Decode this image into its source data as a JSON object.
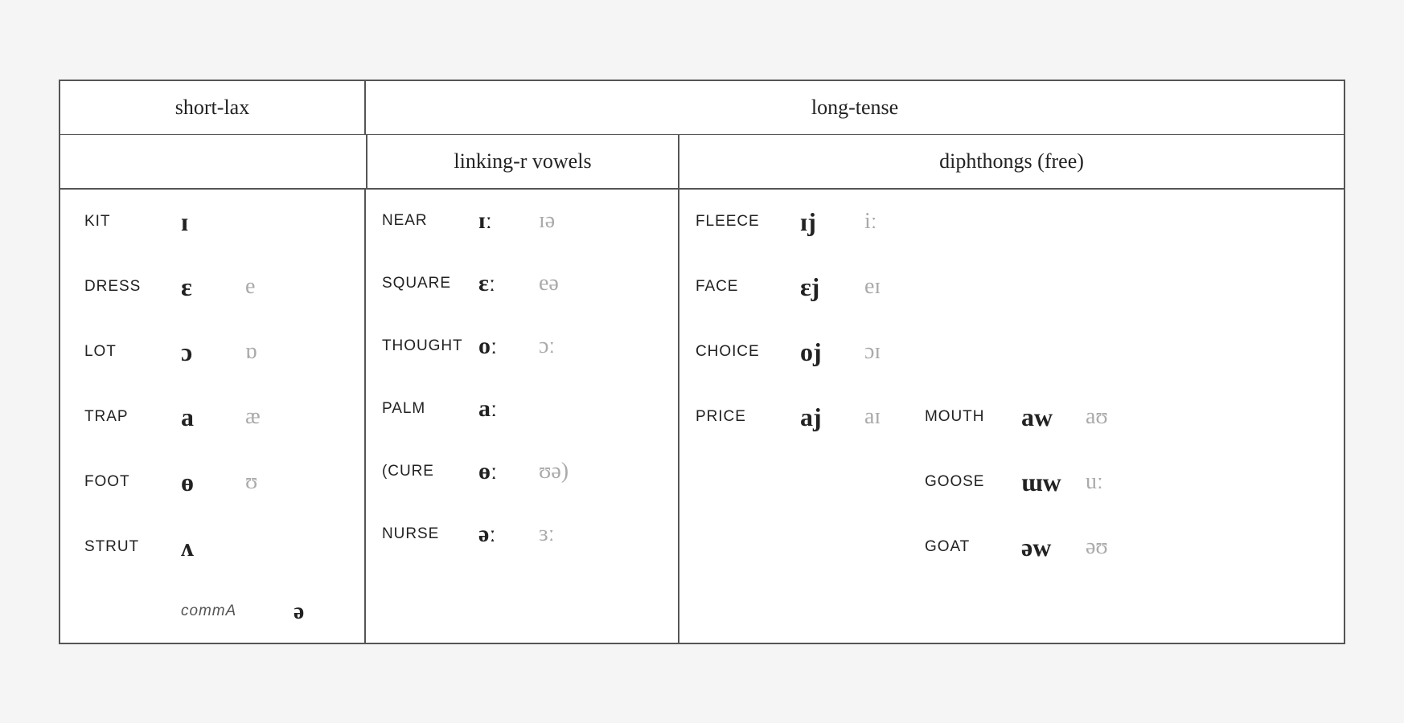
{
  "headers": {
    "short_lax": "short-lax",
    "long_tense": "long-tense",
    "linking_r": "linking-r vowels",
    "diphthongs": "diphthongs (free)"
  },
  "short_lax_rows": [
    {
      "word": "KIT",
      "ipa_primary": "ɪ",
      "ipa_secondary": ""
    },
    {
      "word": "DRESS",
      "ipa_primary": "ɛ",
      "ipa_secondary": "e"
    },
    {
      "word": "LOT",
      "ipa_primary": "ɔ",
      "ipa_secondary": "ɒ"
    },
    {
      "word": "TRAP",
      "ipa_primary": "a",
      "ipa_secondary": "æ"
    },
    {
      "word": "FOOT",
      "ipa_primary": "ɵ",
      "ipa_secondary": "ʊ"
    },
    {
      "word": "STRUT",
      "ipa_primary": "ʌ",
      "ipa_secondary": ""
    }
  ],
  "linking_r_rows": [
    {
      "word": "NEAR",
      "ipa_long": "ɪː",
      "ipa_secondary": "ɪə"
    },
    {
      "word": "SQUARE",
      "ipa_long": "ɛː",
      "ipa_secondary": "eə"
    },
    {
      "word": "THOUGHT",
      "ipa_long": "oː",
      "ipa_secondary": "ɔː"
    },
    {
      "word": "PALM",
      "ipa_long": "aː",
      "ipa_secondary": ""
    },
    {
      "word": "(CURE",
      "ipa_long": "ɵː",
      "ipa_secondary": "ʊə)"
    },
    {
      "word": "NURSE",
      "ipa_long": "əː",
      "ipa_secondary": "ɜː"
    }
  ],
  "linking_r_comma": {
    "word": "commA",
    "ipa": "ə"
  },
  "diphthong_rows": [
    {
      "word1": "FLEECE",
      "d1_primary": "ɪj",
      "d1_secondary": "iː",
      "word2": "",
      "d2_primary": "",
      "d2_secondary": ""
    },
    {
      "word1": "FACE",
      "d1_primary": "ɛj",
      "d1_secondary": "eɪ",
      "word2": "",
      "d2_primary": "",
      "d2_secondary": ""
    },
    {
      "word1": "CHOICE",
      "d1_primary": "oj",
      "d1_secondary": "ɔɪ",
      "word2": "",
      "d2_primary": "",
      "d2_secondary": ""
    },
    {
      "word1": "PRICE",
      "d1_primary": "aj",
      "d1_secondary": "aɪ",
      "word2": "MOUTH",
      "d2_primary": "aw",
      "d2_secondary": "aʊ"
    },
    {
      "word1": "",
      "d1_primary": "",
      "d1_secondary": "",
      "word2": "GOOSE",
      "d2_primary": "ɯw",
      "d2_secondary": "uː"
    },
    {
      "word1": "",
      "d1_primary": "",
      "d1_secondary": "",
      "word2": "GOAT",
      "d2_primary": "əw",
      "d2_secondary": "əʊ"
    }
  ]
}
